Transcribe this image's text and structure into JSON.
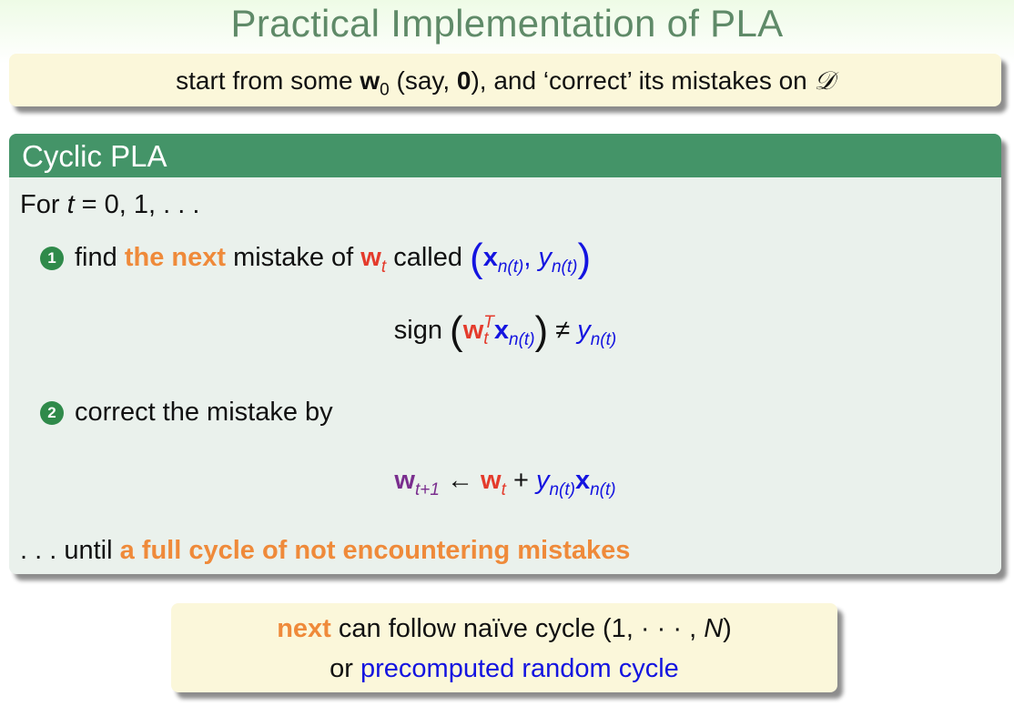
{
  "title": "Practical Implementation of PLA",
  "top_note": {
    "t1": "start from some ",
    "w": "w",
    "sub0": "0",
    "t2": " (say, ",
    "zero": "0",
    "t3": "), and ‘correct’ its mistakes on ",
    "D": "𝒟"
  },
  "block": {
    "header": "Cyclic PLA",
    "for_prefix": "For ",
    "for_t": "t",
    "for_rest": " = 0, 1, . . .",
    "step1": {
      "num": "1",
      "t1": "find ",
      "highlight": "the next",
      "t2": " mistake of ",
      "w": "w",
      "w_sub": "t",
      "t3": " called ",
      "lparen": "(",
      "x": "x",
      "x_sub": "n(t)",
      "comma": ", ",
      "y": "y",
      "y_sub": "n(t)",
      "rparen": ")"
    },
    "eq1": {
      "sign": "sign ",
      "lparen": "(",
      "w": "w",
      "w_sup": "T",
      "w_sub": "t",
      "x": "x",
      "x_sub": "n(t)",
      "rparen": ")",
      "neq": " ≠ ",
      "y": "y",
      "y_sub": "n(t)"
    },
    "step2": {
      "num": "2",
      "text": "correct the mistake by"
    },
    "eq2": {
      "w1": "w",
      "w1_sub": "t+1",
      "arrow": " ← ",
      "w2": "w",
      "w2_sub": "t",
      "plus": " + ",
      "y": "y",
      "y_sub": "n(t)",
      "x": "x",
      "x_sub": "n(t)"
    },
    "until_prefix": ". . . until ",
    "until_highlight": "a full cycle of not encountering mistakes"
  },
  "bottom_note": {
    "next": "next",
    "t1": " can follow naïve cycle (1, · · · , ",
    "N": "N",
    "t2": ")",
    "t3": "or ",
    "random": "precomputed random cycle"
  },
  "colors": {
    "title": "#5f8a68",
    "block_header": "#449468",
    "orange": "#ef8a3a",
    "red": "#e43b2c",
    "blue": "#1414e0",
    "purple": "#7a2e8e"
  }
}
